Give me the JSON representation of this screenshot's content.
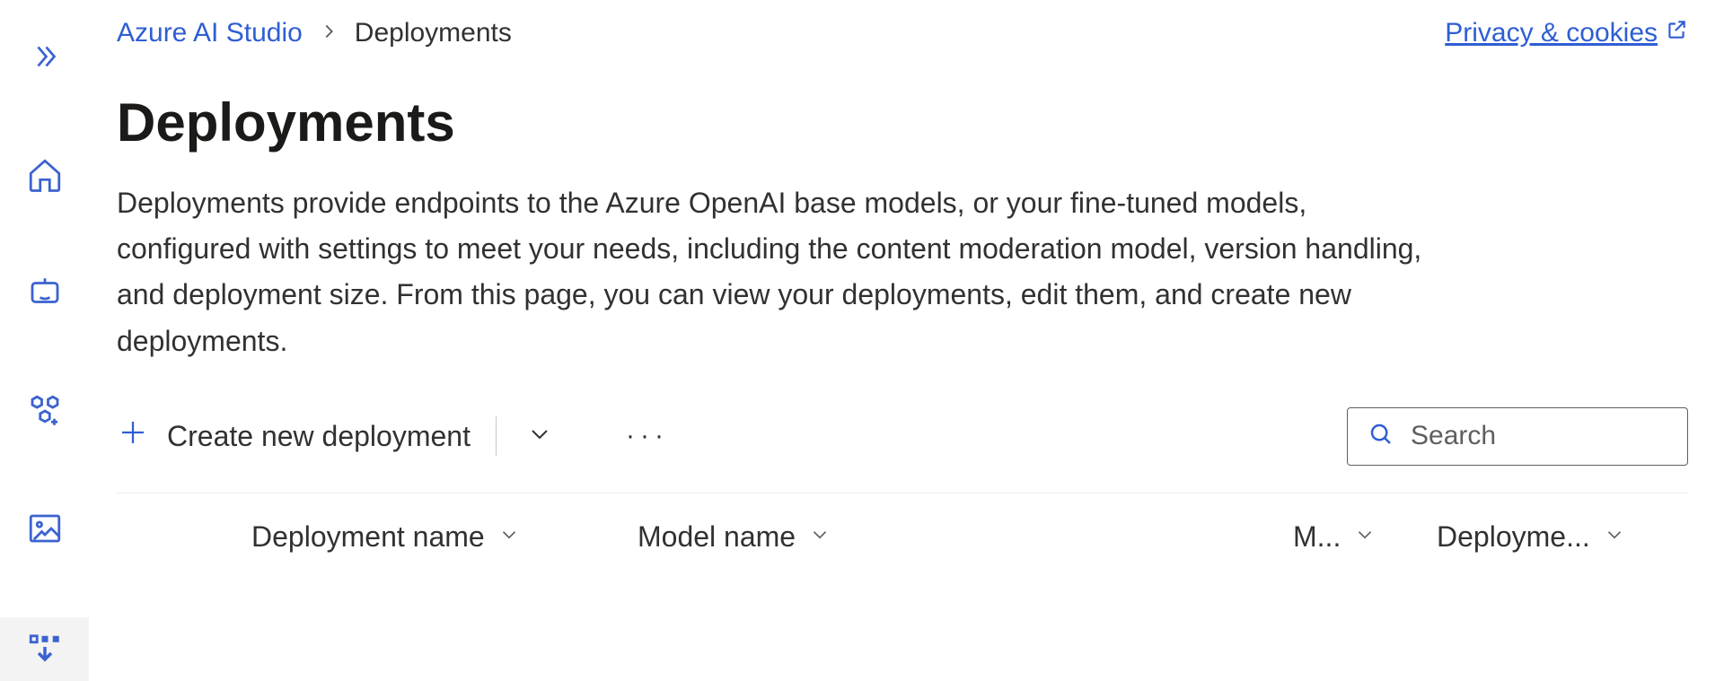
{
  "breadcrumb": {
    "root": "Azure AI Studio",
    "current": "Deployments"
  },
  "privacy_link": "Privacy & cookies",
  "page": {
    "title": "Deployments",
    "description": "Deployments provide endpoints to the Azure OpenAI base models, or your fine-tuned models, configured with settings to meet your needs, including the content moderation model, version handling, and deployment size. From this page, you can view your deployments, edit them, and create new deployments."
  },
  "toolbar": {
    "create_label": "Create new deployment",
    "search_placeholder": "Search"
  },
  "table": {
    "columns": {
      "c1": "Deployment name",
      "c2": "Model name",
      "c3": "M...",
      "c4": "Deployme..."
    }
  },
  "sidebar": {
    "items": [
      {
        "name": "expand"
      },
      {
        "name": "home"
      },
      {
        "name": "chat"
      },
      {
        "name": "models"
      },
      {
        "name": "images"
      },
      {
        "name": "deployments",
        "active": true
      }
    ]
  }
}
